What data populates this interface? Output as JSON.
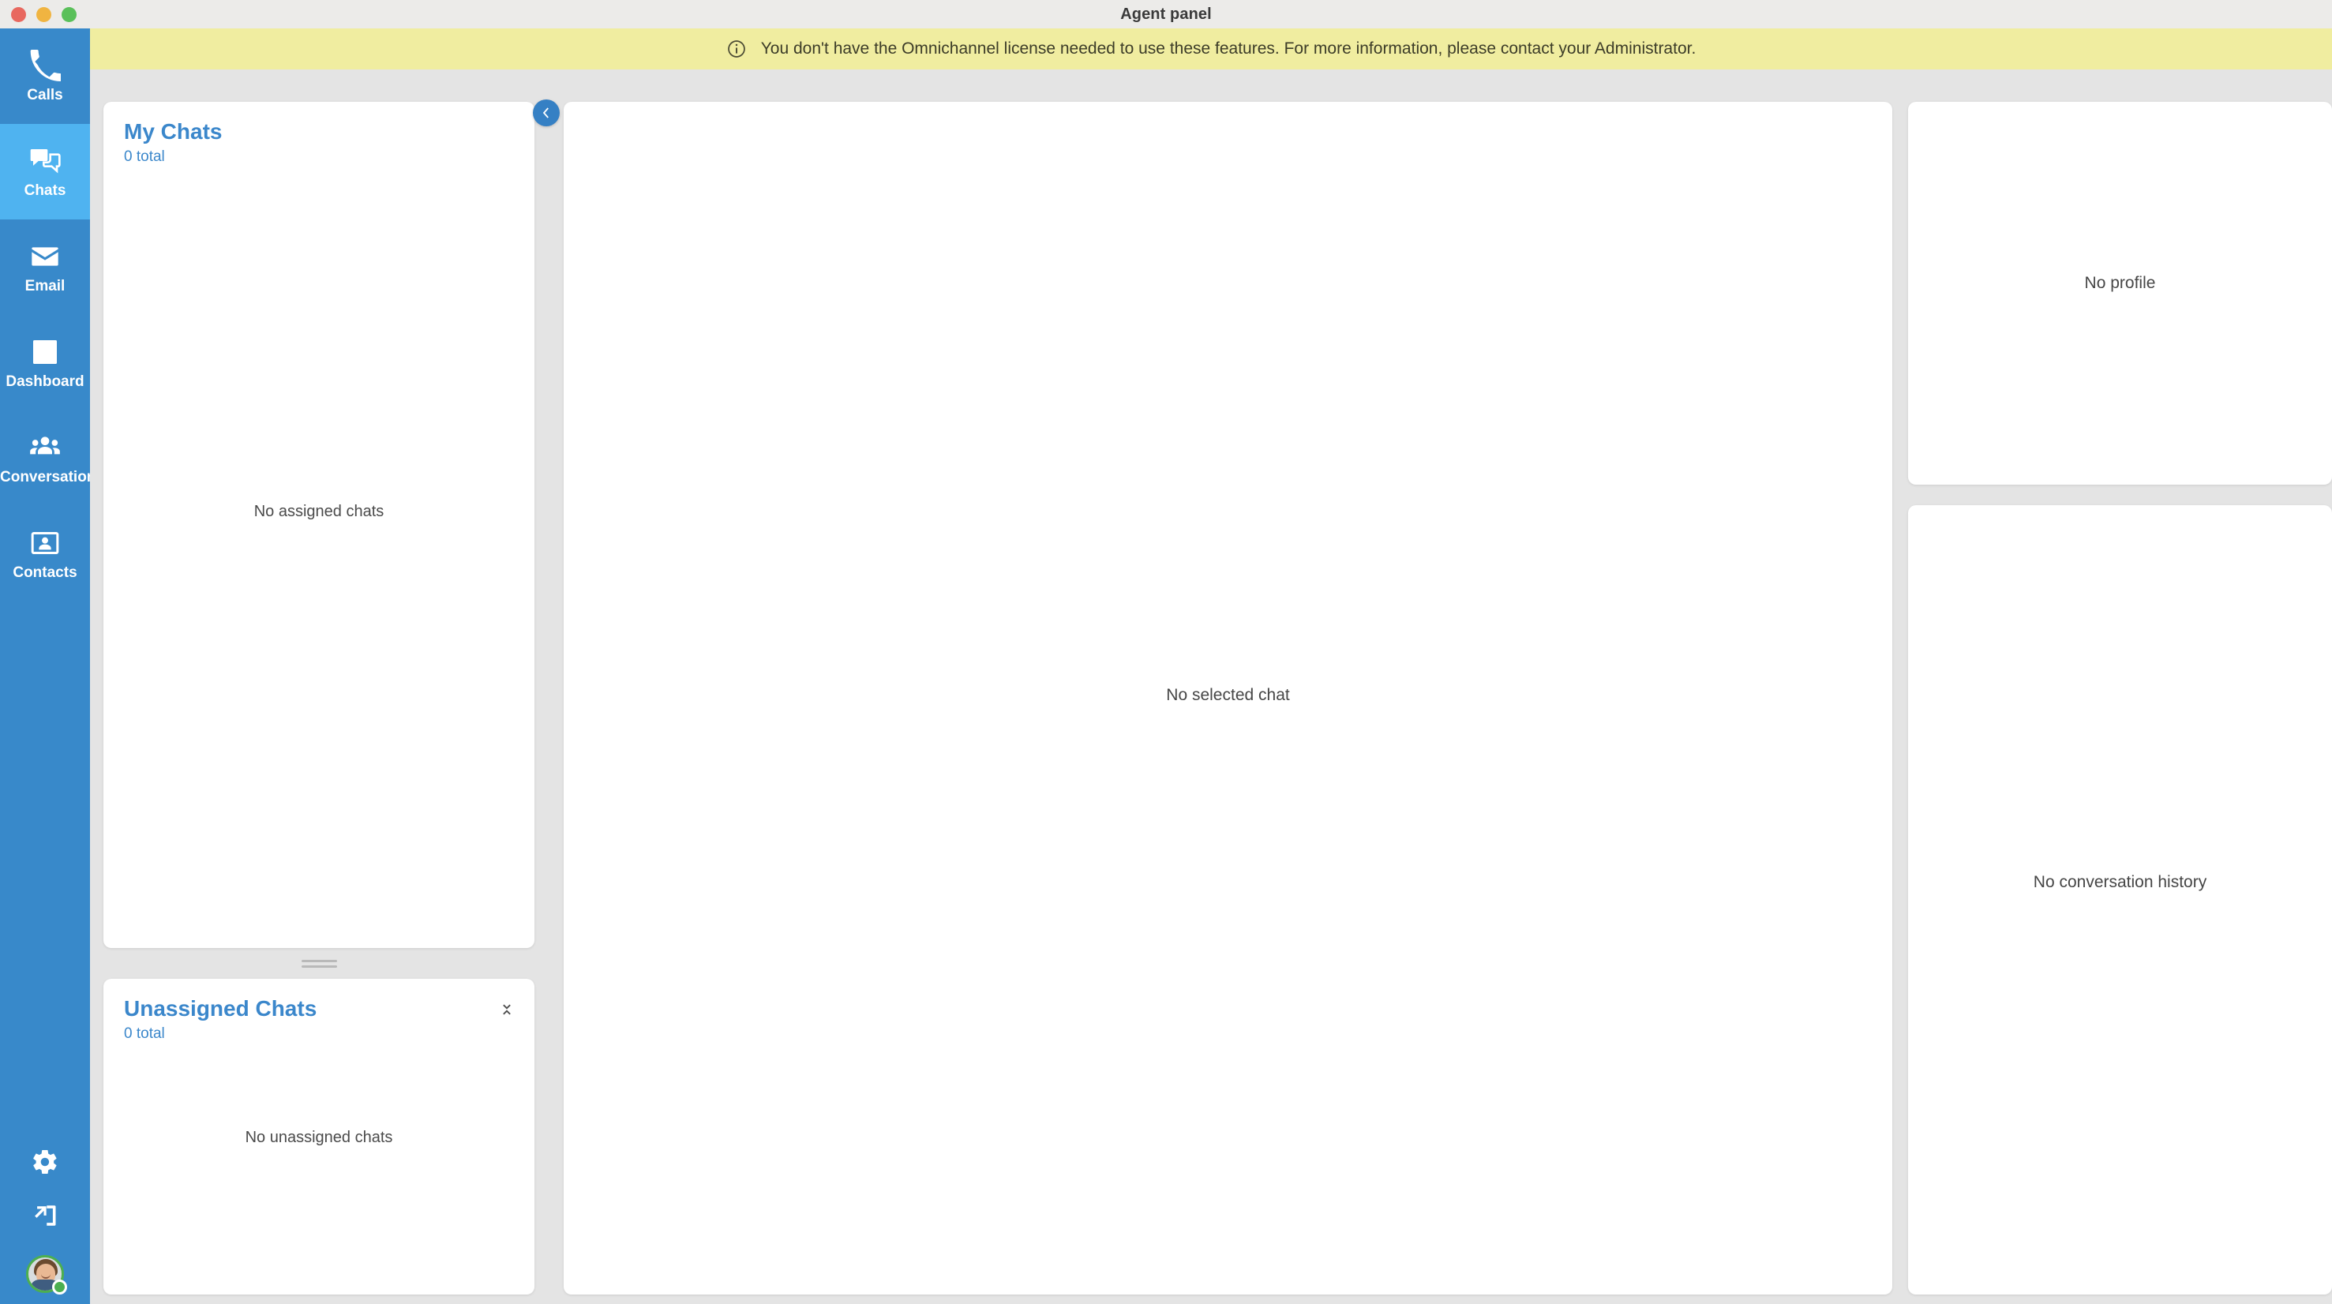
{
  "window": {
    "title": "Agent panel",
    "traffic_lights": [
      {
        "name": "close",
        "color": "#e8685f"
      },
      {
        "name": "minimize",
        "color": "#f0b441"
      },
      {
        "name": "zoom",
        "color": "#5ac05a"
      }
    ]
  },
  "banner": {
    "icon": "info-circle-icon",
    "message": "You don't have the Omnichannel license needed to use these features. For more information, please contact your Administrator.",
    "background_color": "#f0eda0",
    "text_color": "#3c3c28"
  },
  "sidebar": {
    "background_color": "#3889ca",
    "active_color": "#4fb3f0",
    "items": [
      {
        "label": "Calls",
        "icon": "phone-icon",
        "active": false
      },
      {
        "label": "Chats",
        "icon": "chat-bubbles-icon",
        "active": true
      },
      {
        "label": "Email",
        "icon": "envelope-icon",
        "active": false
      },
      {
        "label": "Dashboard",
        "icon": "chart-image-icon",
        "active": false
      },
      {
        "label": "Conversations",
        "icon": "people-group-icon",
        "active": false
      },
      {
        "label": "Contacts",
        "icon": "contact-card-icon",
        "active": false
      }
    ],
    "bottom": [
      {
        "label": "Settings",
        "icon": "gear-icon"
      },
      {
        "label": "Log out",
        "icon": "logout-icon"
      }
    ],
    "user": {
      "status": "online",
      "status_color": "#4caf50",
      "avatar": "user-avatar"
    }
  },
  "panels": {
    "my_chats": {
      "title": "My Chats",
      "subtitle": "0 total",
      "empty_text": "No assigned chats"
    },
    "unassigned_chats": {
      "title": "Unassigned Chats",
      "subtitle": "0 total",
      "empty_text": "No unassigned chats",
      "collapse_icon": "collapse-vertical-icon"
    },
    "chat": {
      "empty_text": "No selected chat",
      "collapse_icon": "chevron-left-icon"
    },
    "profile": {
      "empty_text": "No profile"
    },
    "history": {
      "empty_text": "No conversation history"
    }
  },
  "theme": {
    "accent": "#3b87cb",
    "workspace_background": "#e4e4e4",
    "card_background": "#ffffff"
  }
}
